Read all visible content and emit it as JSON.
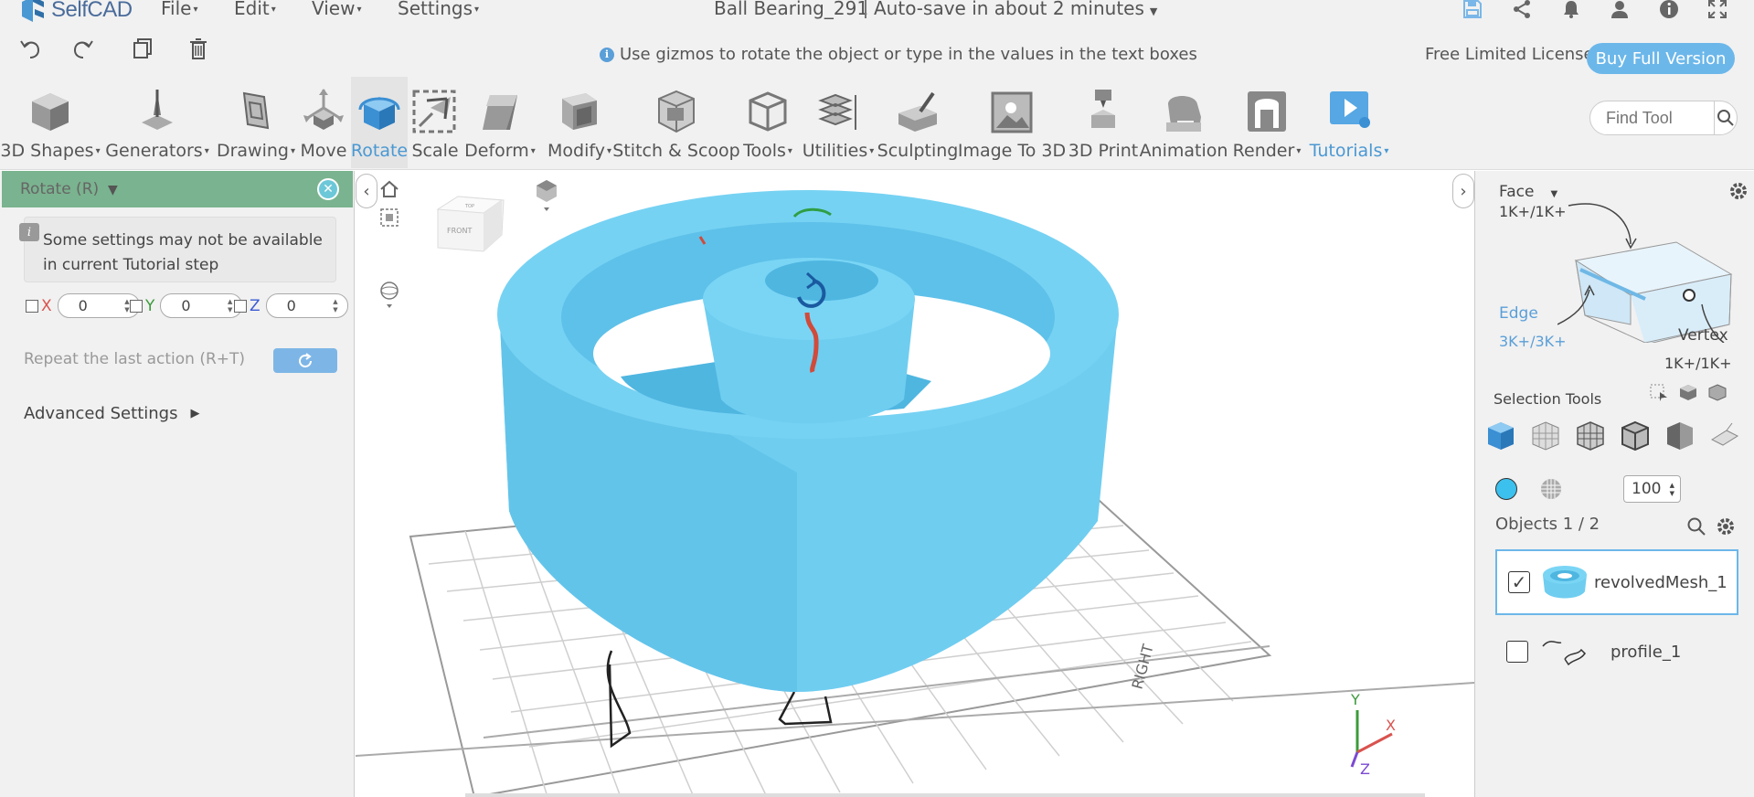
{
  "app": {
    "logo_text": "SelfCAD",
    "document_title": "Ball Bearing_291",
    "autosave": "Auto-save in about 2 minutes"
  },
  "menu": {
    "file": "File",
    "edit": "Edit",
    "view": "View",
    "settings": "Settings"
  },
  "actionbar": {
    "hint": "Use gizmos to rotate the object or type in the values in the text boxes",
    "license": "Free Limited License",
    "buy": "Buy Full Version"
  },
  "toolbar": {
    "shapes": "3D Shapes",
    "generators": "Generators",
    "drawing": "Drawing",
    "move": "Move",
    "rotate": "Rotate",
    "scale": "Scale",
    "deform": "Deform",
    "modify": "Modify",
    "stitch": "Stitch & Scoop",
    "tools": "Tools",
    "utilities": "Utilities",
    "sculpting": "Sculpting",
    "image3d": "Image To 3D",
    "print3d": "3D Print",
    "animation": "Animation",
    "render": "Render",
    "tutorials": "Tutorials",
    "find_placeholder": "Find Tool"
  },
  "left_panel": {
    "title": "Rotate (R)",
    "notice": "Some settings may not be available in current Tutorial step",
    "axis_x": "X",
    "axis_y": "Y",
    "axis_z": "Z",
    "x_value": "0",
    "y_value": "0",
    "z_value": "0",
    "repeat": "Repeat the last action (R+T)",
    "advanced": "Advanced Settings"
  },
  "viewport": {
    "cube_top": "TOP",
    "cube_front": "FRONT",
    "grid_label": "RIGHT",
    "axis_x": "X",
    "axis_y": "Y",
    "axis_z": "Z"
  },
  "right_panel": {
    "face": "Face",
    "face_count": "1K+/1K+",
    "edge": "Edge",
    "edge_count": "3K+/3K+",
    "vertex": "Vertex",
    "vertex_count": "1K+/1K+",
    "selection_tools": "Selection Tools",
    "brush_size": "100",
    "objects_label": "Objects 1 / 2",
    "objects": [
      {
        "name": "revolvedMesh_1",
        "checked": true
      },
      {
        "name": "profile_1",
        "checked": false
      }
    ]
  },
  "colors": {
    "accent": "#4a98d3",
    "object": "#6fcdf0",
    "panel_head": "#7ab38f",
    "buy_button": "#6cb7ea"
  }
}
